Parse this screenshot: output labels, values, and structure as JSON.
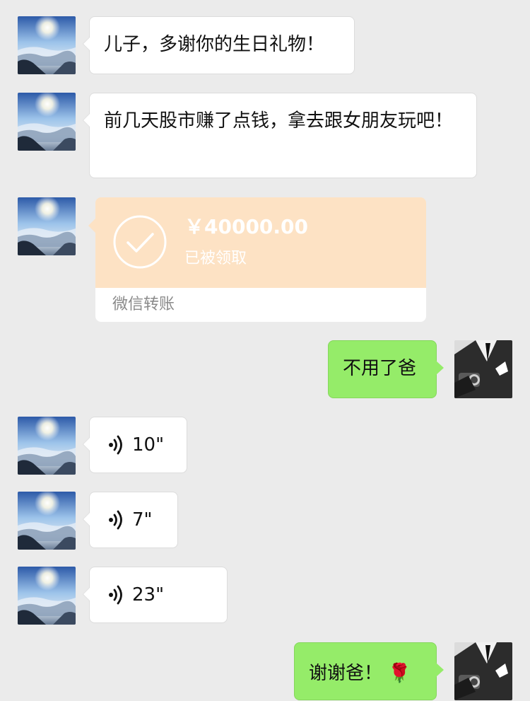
{
  "messages": {
    "m1": {
      "text": "儿子，多谢你的生日礼物！"
    },
    "m2": {
      "text": "前几天股市赚了点钱，拿去跟女朋友玩吧！"
    },
    "transfer": {
      "amount": "￥40000.00",
      "status": "已被领取",
      "label": "微信转账"
    },
    "m4": {
      "text": "不用了爸"
    },
    "voice1": {
      "duration": "10\""
    },
    "voice2": {
      "duration": "7\""
    },
    "voice3": {
      "duration": "23\""
    },
    "m8": {
      "text": "谢谢爸！",
      "emoji": "🌹"
    }
  },
  "icons": {
    "father_avatar": "mountain-sunrise-avatar",
    "son_avatar": "suited-man-watch-avatar",
    "voice": "voice-wave-icon",
    "transfer": "check-circle-icon"
  },
  "colors": {
    "background": "#ebebeb",
    "left_bubble": "#ffffff",
    "right_bubble": "#95ec69",
    "transfer_bg": "#fde2c4"
  }
}
